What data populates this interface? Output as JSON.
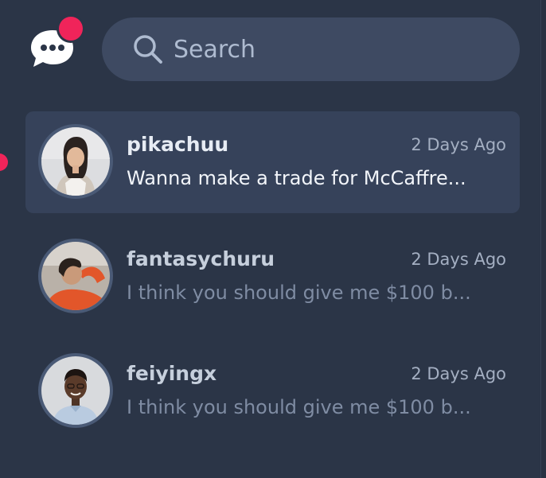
{
  "header": {
    "logo_icon": "chat-bubble-icon",
    "notification_dot_color": "#f0245a"
  },
  "search": {
    "placeholder": "Search",
    "icon": "search-icon"
  },
  "conversations": [
    {
      "username": "pikachuu",
      "time": "2 Days Ago",
      "preview": "Wanna make a trade for McCaffre...",
      "unread": true,
      "active": true
    },
    {
      "username": "fantasychuru",
      "time": "2 Days Ago",
      "preview": "I think you should give me $100 b...",
      "unread": false,
      "active": false
    },
    {
      "username": "feiyingx",
      "time": "2 Days Ago",
      "preview": "I think you should give me $100 b...",
      "unread": false,
      "active": false
    }
  ],
  "colors": {
    "background": "#2b3547",
    "search_bg": "#3e4a62",
    "active_row": "#36425a",
    "accent": "#f0245a"
  }
}
